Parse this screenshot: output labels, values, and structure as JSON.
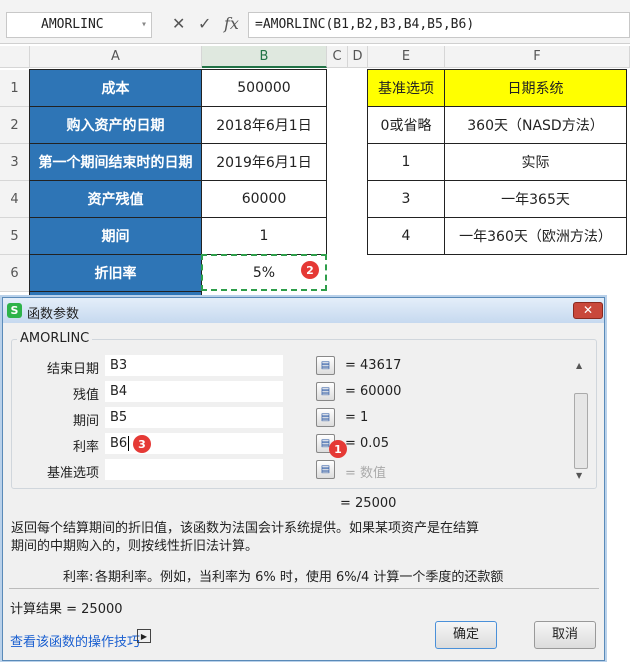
{
  "formula_bar": {
    "name_box": "AMORLINC",
    "cancel_icon": "✕",
    "enter_icon": "✓",
    "fx_label": "fx",
    "formula": "=AMORLINC(B1,B2,B3,B4,B5,B6)"
  },
  "columns": [
    "A",
    "B",
    "C",
    "D",
    "E",
    "F"
  ],
  "rows": [
    "1",
    "2",
    "3",
    "4",
    "5",
    "6"
  ],
  "sheet": {
    "a": [
      "成本",
      "购入资产的日期",
      "第一个期间结束时的日期",
      "资产残值",
      "期间",
      "折旧率"
    ],
    "b": [
      "500000",
      "2018年6月1日",
      "2019年6月1日",
      "60000",
      "1",
      "5%"
    ],
    "e": [
      "基准选项",
      "0或省略",
      "1",
      "3",
      "4"
    ],
    "f": [
      "日期系统",
      "360天（NASD方法）",
      "实际",
      "一年365天",
      "一年360天（欧洲方法）"
    ]
  },
  "badges": [
    "1",
    "2",
    "3"
  ],
  "dialog": {
    "title": "函数参数",
    "function_name": "AMORLINC",
    "close": "✕",
    "fields": [
      {
        "label": "结束日期",
        "value": "B3",
        "result": "= 43617"
      },
      {
        "label": "残值",
        "value": "B4",
        "result": "= 60000"
      },
      {
        "label": "期间",
        "value": "B5",
        "result": "= 1"
      },
      {
        "label": "利率",
        "value": "B6",
        "result": "= 0.05"
      },
      {
        "label": "基准选项",
        "value": "",
        "result": "= 数值"
      }
    ],
    "total": "= 25000",
    "description": "返回每个结算期间的折旧值，该函数为法国会计系统提供。如果某项资产是在结算期间的中期购入的，则按线性折旧法计算。",
    "arg_name": "利率:",
    "arg_desc": "各期利率。例如，当利率为 6% 时，使用 6%/4 计算一个季度的还款额",
    "result_label": "计算结果 = 25000",
    "help_link": "查看该函数的操作技巧",
    "ok": "确定",
    "cancel": "取消"
  }
}
